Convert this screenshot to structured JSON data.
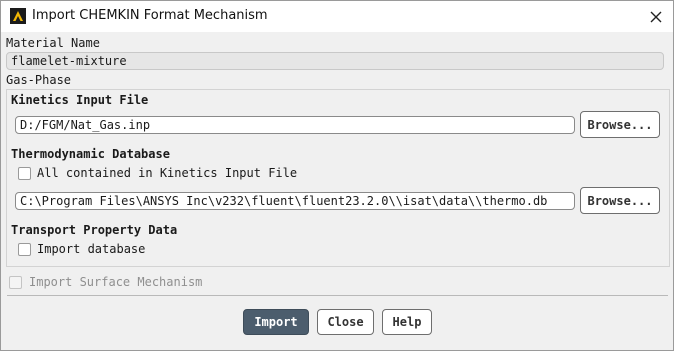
{
  "window": {
    "title": "Import CHEMKIN Format Mechanism"
  },
  "material": {
    "label": "Material Name",
    "value": "flamelet-mixture"
  },
  "gas_phase": {
    "label": "Gas-Phase",
    "kinetics": {
      "label": "Kinetics Input File",
      "value": "D:/FGM/Nat_Gas.inp",
      "browse_label": "Browse..."
    },
    "thermo": {
      "label": "Thermodynamic Database",
      "checkbox_label": "All contained in Kinetics Input File",
      "checked": false,
      "value": "C:\\Program Files\\ANSYS Inc\\v232\\fluent\\fluent23.2.0\\\\isat\\data\\\\thermo.db",
      "browse_label": "Browse..."
    },
    "transport": {
      "label": "Transport Property Data",
      "checkbox_label": "Import database",
      "checked": false
    }
  },
  "surface": {
    "label": "Import Surface Mechanism",
    "checked": false,
    "enabled": false
  },
  "buttons": {
    "import": "Import",
    "close": "Close",
    "help": "Help"
  },
  "colors": {
    "primary_button": "#4c5d6d",
    "background": "#f0f0f0",
    "titlebar": "#ffffff"
  },
  "icons": {
    "app": "ansys-app-icon",
    "close": "close-icon"
  }
}
